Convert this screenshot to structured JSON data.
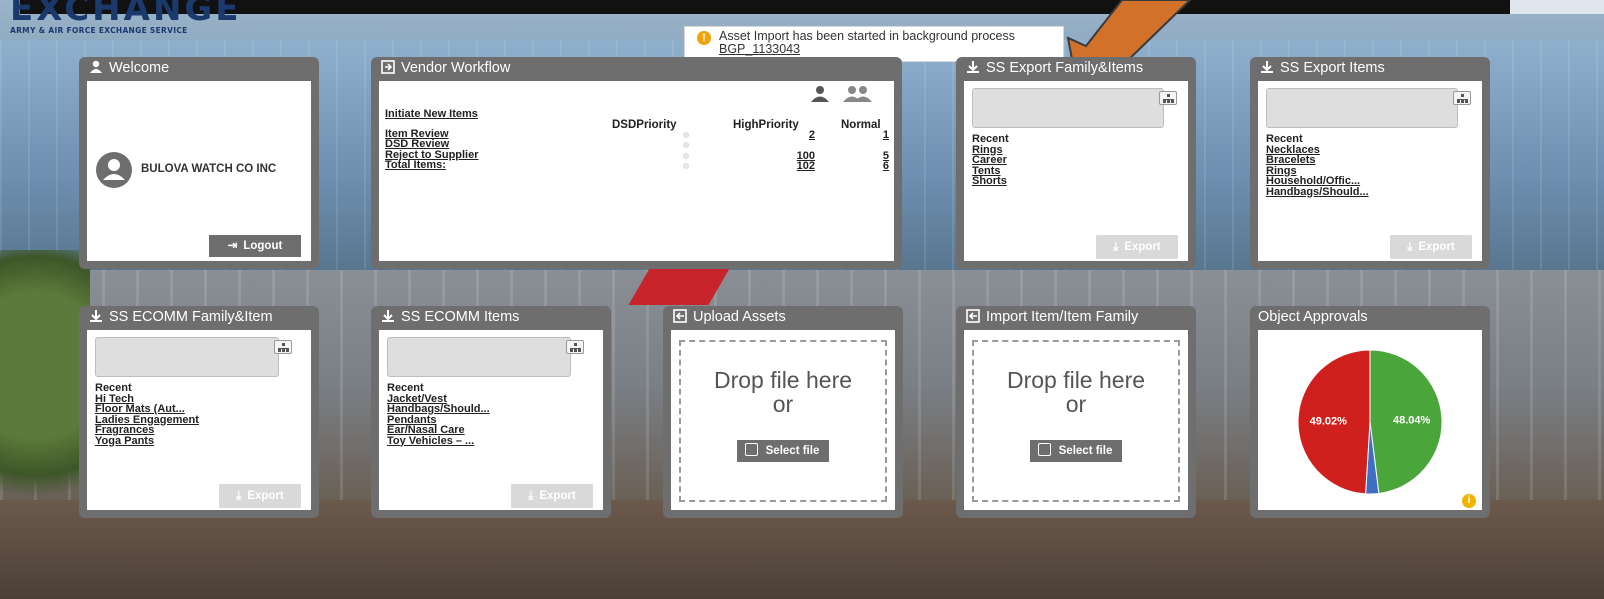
{
  "logo": {
    "title": "EXCHANGE",
    "subtitle": "ARMY & AIR FORCE EXCHANGE SERVICE"
  },
  "notification": {
    "text": "Asset Import has been started in background process",
    "link": "BGP_1133043"
  },
  "welcome": {
    "title": "Welcome",
    "user": "BULOVA WATCH CO INC",
    "logout_label": "Logout"
  },
  "vendor_workflow": {
    "title": "Vendor Workflow",
    "initiate_label": "Initiate New Items",
    "columns": [
      "DSDPriority",
      "HighPriority",
      "Normal"
    ],
    "rows": [
      {
        "label": "Item Review",
        "high": "2",
        "normal": "1"
      },
      {
        "label": "DSD Review",
        "high": "",
        "normal": ""
      },
      {
        "label": "Reject to Supplier",
        "high": "100",
        "normal": "5"
      },
      {
        "label": "Total Items:",
        "high": "102",
        "normal": "6"
      }
    ]
  },
  "ss_export_family": {
    "title": "SS Export Family&Items",
    "recent_label": "Recent",
    "items": [
      "Rings",
      "Career",
      "Tents",
      "Shorts"
    ],
    "export_label": "Export"
  },
  "ss_export_items": {
    "title": "SS Export Items",
    "recent_label": "Recent",
    "items": [
      "Necklaces",
      "Bracelets",
      "Rings",
      "Household/Offic...",
      "Handbags/Should..."
    ],
    "export_label": "Export"
  },
  "ss_ecomm_family": {
    "title": "SS ECOMM Family&Item",
    "recent_label": "Recent",
    "items": [
      "Hi Tech",
      "Floor Mats (Aut...",
      "Ladies Engagement",
      "Fragrances",
      "Yoga Pants"
    ],
    "export_label": "Export"
  },
  "ss_ecomm_items": {
    "title": "SS ECOMM Items",
    "recent_label": "Recent",
    "items": [
      "Jacket/Vest",
      "Handbags/Should...",
      "Pendants",
      "Ear/Nasal Care",
      "Toy Vehicles – ..."
    ],
    "export_label": "Export"
  },
  "upload_assets": {
    "title": "Upload Assets",
    "drop_text": "Drop file here",
    "or_text": "or",
    "select_label": "Select file"
  },
  "import_item": {
    "title": "Import Item/Item Family",
    "drop_text": "Drop file here",
    "or_text": "or",
    "select_label": "Select file"
  },
  "object_approvals": {
    "title": "Object Approvals",
    "slices": [
      {
        "label": "49.02%",
        "value": 49.02,
        "color": "#d0201e"
      },
      {
        "label": "48.04%",
        "value": 48.04,
        "color": "#4aa63a"
      },
      {
        "label": "",
        "value": 2.94,
        "color": "#3f6fc4"
      }
    ]
  }
}
